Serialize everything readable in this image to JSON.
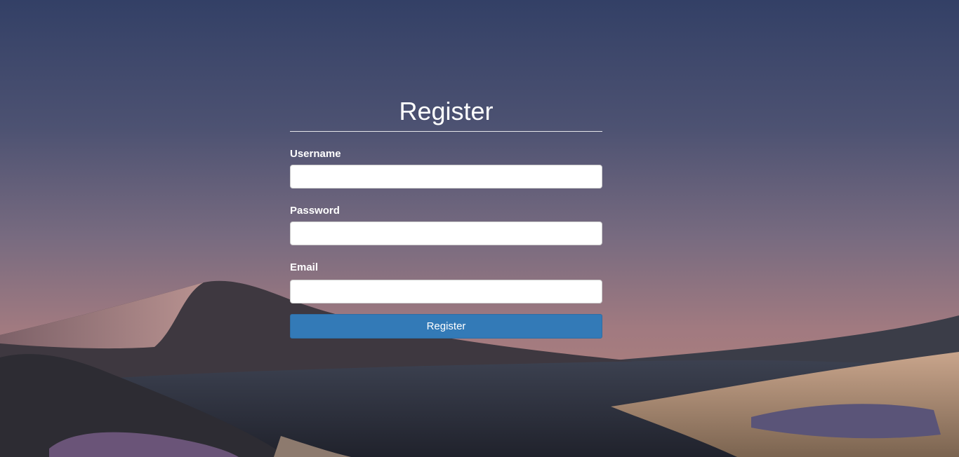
{
  "form": {
    "title": "Register",
    "fields": [
      {
        "label": "Username",
        "value": "",
        "placeholder": ""
      },
      {
        "label": "Password",
        "value": "",
        "placeholder": ""
      },
      {
        "label": "Email",
        "value": "",
        "placeholder": ""
      }
    ],
    "submit_label": "Register"
  },
  "colors": {
    "sky_top": "#344266",
    "sky_horizon": "#b07f80",
    "button": "#337ab7",
    "text": "#ffffff"
  }
}
